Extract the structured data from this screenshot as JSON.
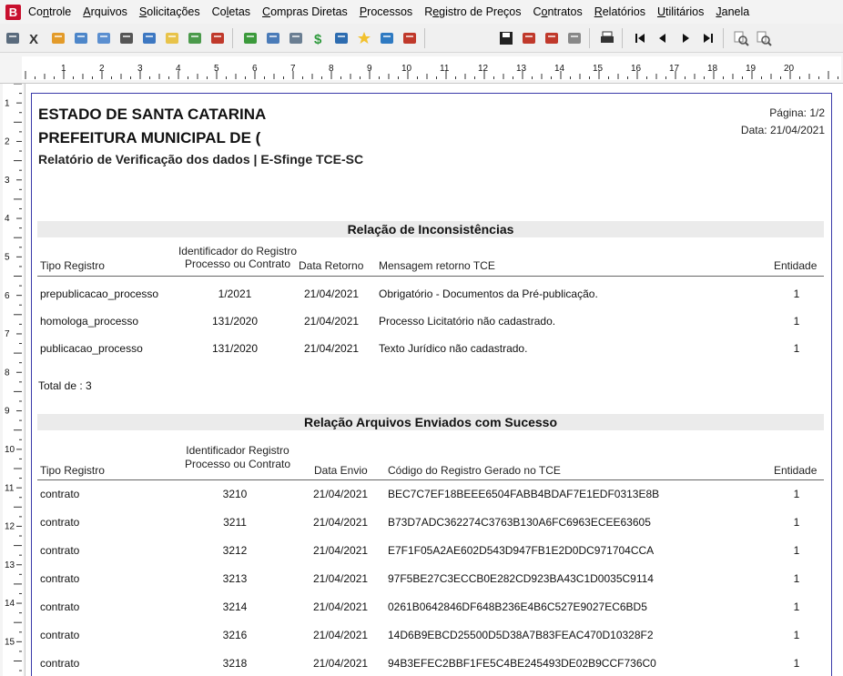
{
  "app": {
    "logo_letter": "B"
  },
  "menu": [
    {
      "label": "Controle",
      "mnemonic": "n",
      "pre": "Co",
      "post": "trole"
    },
    {
      "label": "Arquivos",
      "mnemonic": "A",
      "pre": "",
      "post": "rquivos"
    },
    {
      "label": "Solicitações",
      "mnemonic": "S",
      "pre": "",
      "post": "olicitações"
    },
    {
      "label": "Coletas",
      "mnemonic": "l",
      "pre": "Co",
      "post": "etas"
    },
    {
      "label": "Compras Diretas",
      "mnemonic": "C",
      "pre": "",
      "post": "ompras Diretas"
    },
    {
      "label": "Processos",
      "mnemonic": "P",
      "pre": "",
      "post": "rocessos"
    },
    {
      "label": "Registro de Preços",
      "mnemonic": "e",
      "pre": "R",
      "post": "gistro de Preços"
    },
    {
      "label": "Contratos",
      "mnemonic": "o",
      "pre": "C",
      "post": "ntratos"
    },
    {
      "label": "Relatórios",
      "mnemonic": "R",
      "pre": "",
      "post": "elatórios"
    },
    {
      "label": "Utilitários",
      "mnemonic": "U",
      "pre": "",
      "post": "tilitários"
    },
    {
      "label": "Janela",
      "mnemonic": "J",
      "pre": "",
      "post": "anela"
    }
  ],
  "toolbar": {
    "left_icons": [
      "scanner-icon",
      "scissors-icon",
      "folder-icon",
      "truck-icon",
      "form-icon",
      "barcode-icon",
      "cart-icon",
      "document-icon",
      "table-icon",
      "hammer-icon"
    ],
    "mid_icons": [
      "tree-icon",
      "calculator-icon",
      "monitor-icon",
      "dollar-icon",
      "mail-icon",
      "star-icon",
      "window-icon",
      "book-icon"
    ],
    "right_icons": [
      "save-icon",
      "pdf-icon",
      "export-icon",
      "copy-icon",
      "print-icon",
      "first-page-icon",
      "prev-page-icon",
      "next-page-icon",
      "last-page-icon",
      "zoom-out-icon",
      "zoom-in-icon"
    ]
  },
  "ruler": {
    "h_numbers": [
      "1",
      "2",
      "3",
      "4",
      "5",
      "6",
      "7",
      "8",
      "9",
      "10",
      "11",
      "12",
      "13",
      "14",
      "15",
      "16",
      "17",
      "18",
      "19",
      "20"
    ],
    "v_numbers": [
      "1",
      "2",
      "3",
      "4",
      "5",
      "6",
      "7",
      "8",
      "9",
      "10",
      "11",
      "12",
      "13",
      "14",
      "15"
    ]
  },
  "report": {
    "title1": "ESTADO DE SANTA CATARINA",
    "title2": "PREFEITURA MUNICIPAL DE (",
    "title3": "Relatório de Verificação dos dados | E-Sfinge TCE-SC",
    "page_label": "Página: 1/2",
    "date_label": "Data: 21/04/2021",
    "inconsistencies": {
      "section_title": "Relação de Inconsistências",
      "headers": {
        "tipo": "Tipo Registro",
        "ident_line1": "Identificador do Registro",
        "ident_line2": "Processo ou Contrato",
        "data": "Data Retorno",
        "msg": "Mensagem retorno TCE",
        "entidade": "Entidade"
      },
      "rows": [
        {
          "tipo": "prepublicacao_processo",
          "ident": "1/2021",
          "data": "21/04/2021",
          "msg": "Obrigatório - Documentos da Pré-publicação.",
          "entidade": "1"
        },
        {
          "tipo": "homologa_processo",
          "ident": "131/2020",
          "data": "21/04/2021",
          "msg": "Processo Licitatório não cadastrado.",
          "entidade": "1"
        },
        {
          "tipo": "publicacao_processo",
          "ident": "131/2020",
          "data": "21/04/2021",
          "msg": "Texto Jurídico não cadastrado.",
          "entidade": "1"
        }
      ],
      "total": "Total de : 3"
    },
    "success": {
      "section_title": "Relação Arquivos Enviados com Sucesso",
      "headers": {
        "tipo": "Tipo Registro",
        "ident_line1": "Identificador Registro",
        "ident_line2": "Processo ou Contrato",
        "data": "Data Envio",
        "code": "Código do Registro Gerado no TCE",
        "entidade": "Entidade"
      },
      "rows": [
        {
          "tipo": "contrato",
          "ident": "3210",
          "data": "21/04/2021",
          "code": "BEC7C7EF18BEEE6504FABB4BDAF7E1EDF0313E8B",
          "entidade": "1"
        },
        {
          "tipo": "contrato",
          "ident": "3211",
          "data": "21/04/2021",
          "code": "B73D7ADC362274C3763B130A6FC6963ECEE63605",
          "entidade": "1"
        },
        {
          "tipo": "contrato",
          "ident": "3212",
          "data": "21/04/2021",
          "code": "E7F1F05A2AE602D543D947FB1E2D0DC971704CCA",
          "entidade": "1"
        },
        {
          "tipo": "contrato",
          "ident": "3213",
          "data": "21/04/2021",
          "code": "97F5BE27C3ECCB0E282CD923BA43C1D0035C9114",
          "entidade": "1"
        },
        {
          "tipo": "contrato",
          "ident": "3214",
          "data": "21/04/2021",
          "code": "0261B0642846DF648B236E4B6C527E9027EC6BD5",
          "entidade": "1"
        },
        {
          "tipo": "contrato",
          "ident": "3216",
          "data": "21/04/2021",
          "code": "14D6B9EBCD25500D5D38A7B83FEAC470D10328F2",
          "entidade": "1"
        },
        {
          "tipo": "contrato",
          "ident": "3218",
          "data": "21/04/2021",
          "code": "94B3EFEC2BBF1FE5C4BE245493DE02B9CCF736C0",
          "entidade": "1"
        }
      ]
    }
  },
  "colors": {
    "page_border": "#3a3aa8",
    "section_bg": "#ebebeb",
    "logo": "#c8102e"
  }
}
